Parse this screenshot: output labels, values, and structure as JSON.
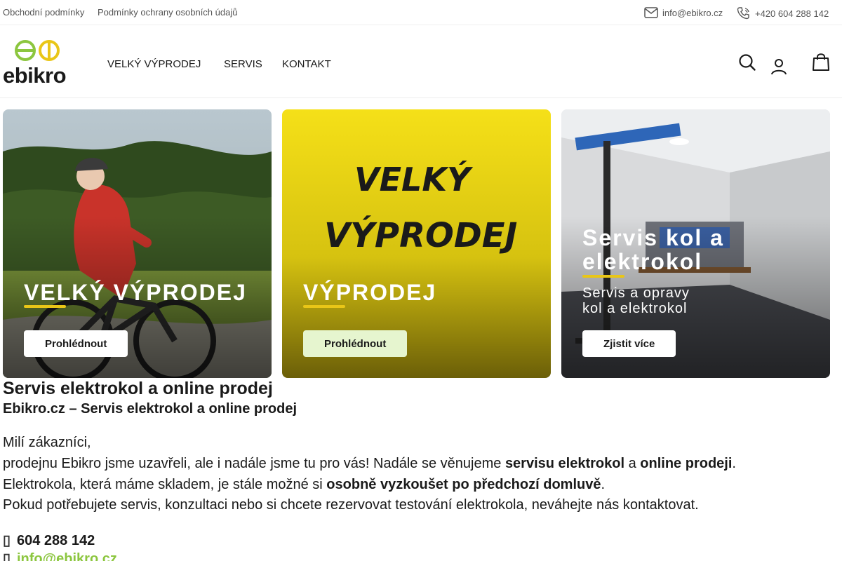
{
  "topbar": {
    "links": [
      "Obchodní podmínky",
      "Podmínky ochrany osobních údajů"
    ],
    "email": "info@ebikro.cz",
    "phone": "+420 604 288 142"
  },
  "header": {
    "logo_text": "ebikro",
    "nav": [
      "VELKÝ VÝPRODEJ",
      "SERVIS",
      "KONTAKT"
    ]
  },
  "cards": [
    {
      "title": "VELKÝ VÝPRODEJ",
      "subtitle": "",
      "button": "Prohlédnout",
      "image": "cyclist-on-ebike"
    },
    {
      "title": "VÝPRODEJ",
      "subtitle": "",
      "button": "Prohlédnout",
      "image_text": [
        "VELKÝ",
        "VÝPRODEJ"
      ]
    },
    {
      "title_lines": [
        "Servis kol a",
        "elektrokol"
      ],
      "subtitle_lines": [
        "Servis a opravy",
        "kol a elektrokol"
      ],
      "button": "Zjistit více",
      "image": "bike-workshop"
    }
  ],
  "content": {
    "heading": "Servis elektrokol a online prodej",
    "subheading": "Ebikro.cz – Servis elektrokol a online prodej",
    "greeting": "Milí zákazníci,",
    "line1": {
      "a": "prodejnu Ebikro jsme uzavřeli, ale i nadále jsme tu pro vás! Nadále se věnujeme ",
      "b": "servisu elektrokol",
      "c": " a ",
      "d": "online prodeji",
      "e": "."
    },
    "line2": {
      "a": "Elektrokola, která máme skladem, je stále možné si ",
      "b": "osobně vyzkoušet po předchozí domluvě",
      "c": "."
    },
    "line3": "Pokud potřebujete servis, konzultaci nebo si chcete rezervovat testování elektrokola, neváhejte nás kontaktovat.",
    "phone": "604 288 142",
    "email": "info@ebikro.cz"
  },
  "colors": {
    "accent_yellow": "#e9c617",
    "link_green": "#8cc63f",
    "light_green_button": "#e6f5cf"
  }
}
